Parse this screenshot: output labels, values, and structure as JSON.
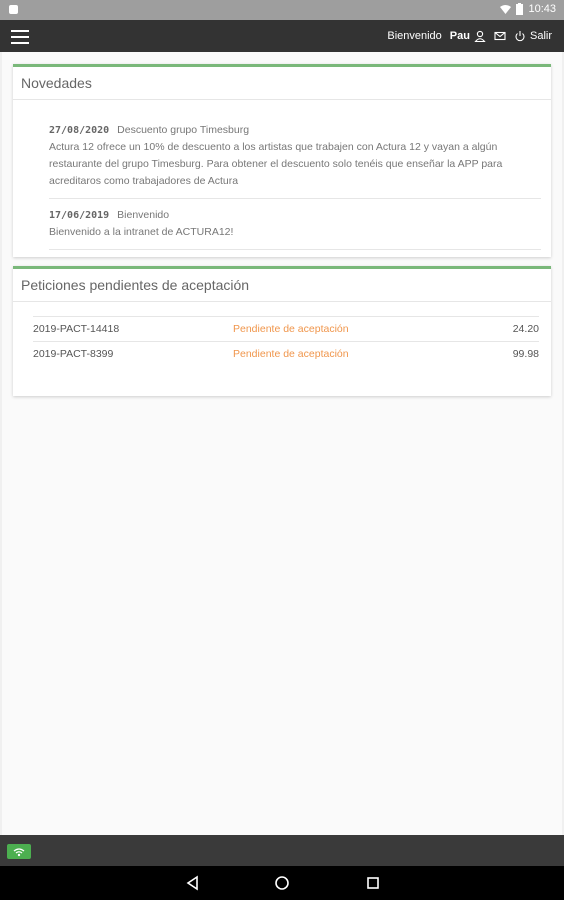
{
  "status_bar": {
    "time": "10:43"
  },
  "nav": {
    "welcome": "Bienvenido",
    "user": "Pau",
    "logout": "Salir"
  },
  "news": {
    "title": "Novedades",
    "items": [
      {
        "date": "27/08/2020",
        "subject": "Descuento grupo Timesburg",
        "body": "Actura 12 ofrece un 10% de descuento a los artistas que trabajen con Actura 12 y vayan a algún restaurante del grupo Timesburg. Para obtener el descuento solo tenéis que enseñar la APP para acreditaros como trabajadores de Actura"
      },
      {
        "date": "17/06/2019",
        "subject": "Bienvenido",
        "body": "Bienvenido a la intranet de ACTURA12!"
      }
    ]
  },
  "requests": {
    "title": "Peticiones pendientes de aceptación",
    "rows": [
      {
        "id": "2019-PACT-14418",
        "status": "Pendiente de aceptación",
        "amount": "24.20"
      },
      {
        "id": "2019-PACT-8399",
        "status": "Pendiente de aceptación",
        "amount": "99.98"
      }
    ]
  },
  "colors": {
    "accent_green": "#7ab87a",
    "pending_orange": "#f0964c",
    "navbar": "#333333"
  }
}
